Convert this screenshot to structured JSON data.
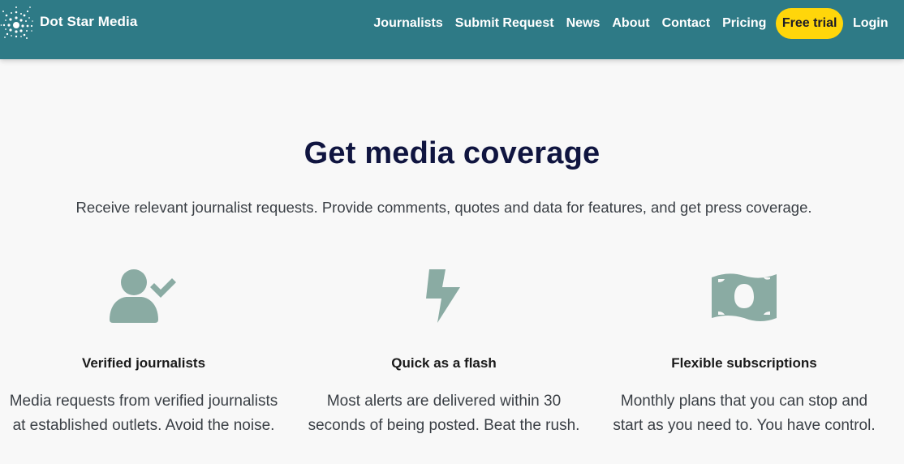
{
  "brand": {
    "name": "Dot Star Media",
    "logo_icon": "dot-star-logo-icon"
  },
  "nav": {
    "items": [
      {
        "label": "Journalists"
      },
      {
        "label": "Submit Request"
      },
      {
        "label": "News"
      },
      {
        "label": "About"
      },
      {
        "label": "Contact"
      },
      {
        "label": "Pricing"
      }
    ],
    "trial_label": "Free trial",
    "login_label": "Login"
  },
  "hero": {
    "title": "Get media coverage",
    "subtitle": "Receive relevant journalist requests. Provide comments, quotes and data for features, and get press coverage."
  },
  "features": [
    {
      "icon": "verified-user-icon",
      "title": "Verified journalists",
      "text": "Media requests from verified journalists at established outlets. Avoid the noise."
    },
    {
      "icon": "lightning-bolt-icon",
      "title": "Quick as a flash",
      "text": "Most alerts are delivered within 30 seconds of being posted. Beat the rush."
    },
    {
      "icon": "money-bill-icon",
      "title": "Flexible subscriptions",
      "text": "Monthly plans that you can stop and start as you need to. You have control."
    }
  ],
  "colors": {
    "navbar": "#2e7a86",
    "accent": "#ffd60a",
    "icon": "#8aaba3",
    "heading": "#101540"
  }
}
